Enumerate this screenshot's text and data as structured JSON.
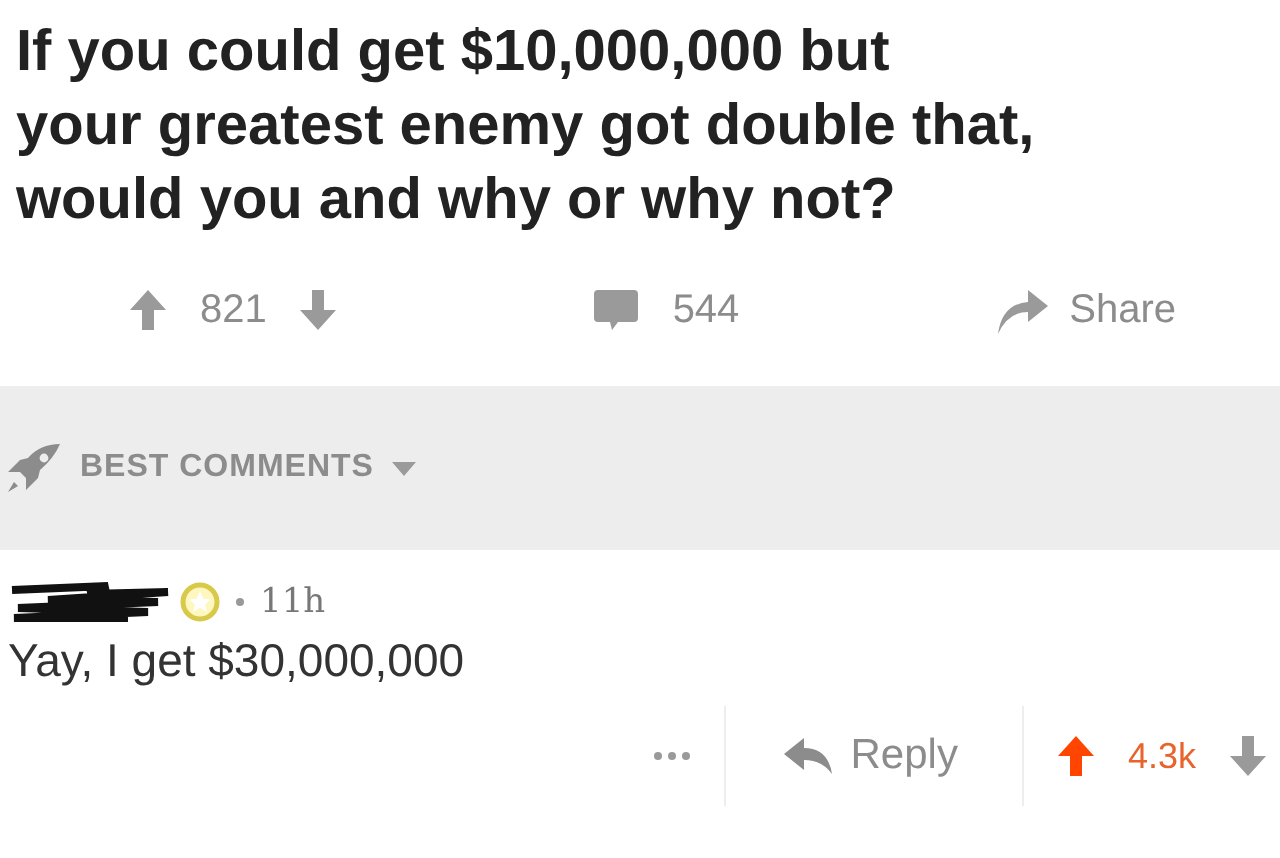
{
  "post": {
    "title": "If you could get $10,000,000 but\nyour greatest enemy got double that,\nwould you and why or why not?",
    "score": "821",
    "upvoted": false,
    "comments": "544",
    "share": "Share"
  },
  "sort": {
    "label": "BEST COMMENTS"
  },
  "comment": {
    "time": "11h",
    "body": "Yay, I get $30,000,000",
    "reply": "Reply",
    "score": "4.3k",
    "upvoted": true
  }
}
